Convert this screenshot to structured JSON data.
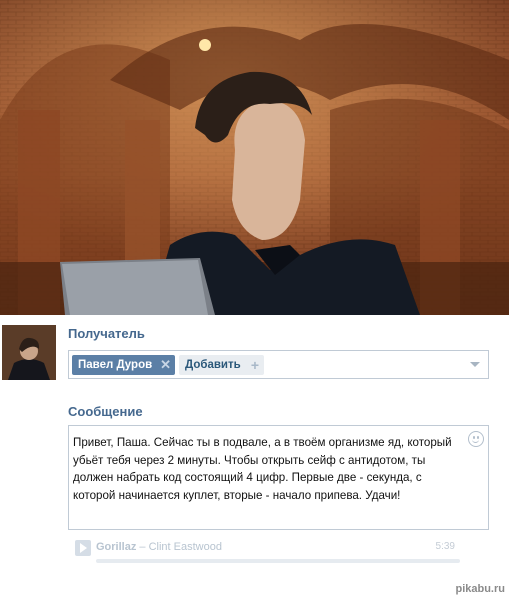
{
  "recipient": {
    "label": "Получатель",
    "token_name": "Павел Дуров",
    "add_label": "Добавить"
  },
  "message": {
    "label": "Сообщение",
    "text": "Привет, Паша. Сейчас ты в подвале, а в твоём организме яд, который убьёт тебя через 2 минуты. Чтобы открыть сейф с антидотом, ты должен набрать код состоящий 4 цифр. Первые две - секунда, с которой начинается куплет, вторые - начало припева. Удачи!"
  },
  "audio": {
    "artist": "Gorillaz",
    "separator": " – ",
    "title": "Clint Eastwood",
    "duration": "5:39"
  },
  "watermark": "pikabu.ru",
  "colors": {
    "label": "#45688e",
    "token_bg": "#5b7fa6",
    "border": "#c0cad5"
  }
}
